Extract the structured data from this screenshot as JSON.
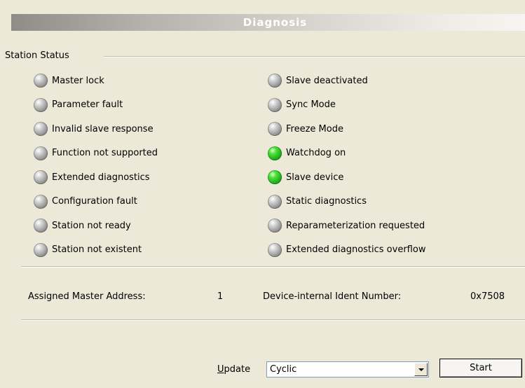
{
  "title": "Diagnosis",
  "station_status": {
    "label": "Station Status",
    "left": [
      {
        "label": "Master lock",
        "state": "off"
      },
      {
        "label": "Parameter fault",
        "state": "off"
      },
      {
        "label": "Invalid slave response",
        "state": "off"
      },
      {
        "label": "Function not supported",
        "state": "off"
      },
      {
        "label": "Extended diagnostics",
        "state": "off"
      },
      {
        "label": "Configuration fault",
        "state": "off"
      },
      {
        "label": "Station not ready",
        "state": "off"
      },
      {
        "label": "Station not existent",
        "state": "off"
      }
    ],
    "right": [
      {
        "label": "Slave deactivated",
        "state": "off"
      },
      {
        "label": "Sync Mode",
        "state": "off"
      },
      {
        "label": "Freeze Mode",
        "state": "off"
      },
      {
        "label": "Watchdog on",
        "state": "on"
      },
      {
        "label": "Slave device",
        "state": "on"
      },
      {
        "label": "Static diagnostics",
        "state": "off"
      },
      {
        "label": "Reparameterization requested",
        "state": "off"
      },
      {
        "label": "Extended diagnostics overflow",
        "state": "off"
      }
    ]
  },
  "info": {
    "master_address_label": "Assigned Master Address:",
    "master_address_value": "1",
    "ident_label": "Device-internal Ident Number:",
    "ident_value": "0x7508"
  },
  "update": {
    "label_first": "U",
    "label_rest": "pdate",
    "selected": "Cyclic"
  },
  "start_label": "Start",
  "colors": {
    "led_on": "#2ecc2e",
    "led_off": "#9a9a9a",
    "background": "#ece9d8"
  }
}
